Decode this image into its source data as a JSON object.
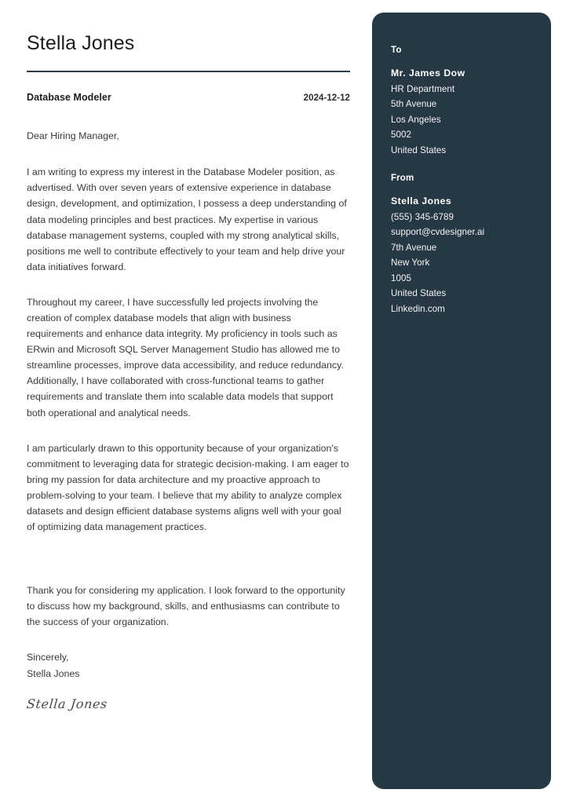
{
  "document": {
    "type": "cover-letter",
    "accent_color": "#273845",
    "page_background": "#ffffff",
    "body_text_color": "#3a3a3a"
  },
  "header": {
    "sender_name": "Stella Jones",
    "job_title": "Database Modeler",
    "date": "2024-12-12"
  },
  "letter": {
    "salutation": "Dear Hiring Manager,",
    "paragraphs": [
      "I am writing to express my interest in the Database Modeler position, as advertised. With over seven years of extensive experience in database design, development, and optimization, I possess a deep understanding of data modeling principles and best practices. My expertise in various database management systems, coupled with my strong analytical skills, positions me well to contribute effectively to your team and help drive your data initiatives forward.",
      "Throughout my career, I have successfully led projects involving the creation of complex database models that align with business requirements and enhance data integrity. My proficiency in tools such as ERwin and Microsoft SQL Server Management Studio has allowed me to streamline processes, improve data accessibility, and reduce redundancy. Additionally, I have collaborated with cross-functional teams to gather requirements and translate them into scalable data models that support both operational and analytical needs.",
      "I am particularly drawn to this opportunity because of your organization's commitment to leveraging data for strategic decision-making. I am eager to bring my passion for data architecture and my proactive approach to problem-solving to your team. I believe that my ability to analyze complex datasets and design efficient database systems aligns well with your goal of optimizing data management practices.",
      "Thank you for considering my application. I look forward to the opportunity to discuss how my background, skills, and enthusiasms can contribute to the success of your organization."
    ],
    "closing_salutation": "Sincerely,",
    "closing_name": "Stella Jones",
    "signature": "Stella Jones"
  },
  "sidebar": {
    "to": {
      "label": "To",
      "name": "Mr. James Dow",
      "lines": [
        "HR Department",
        "5th Avenue",
        "Los Angeles",
        "5002",
        "United States"
      ]
    },
    "from": {
      "label": "From",
      "name": "Stella Jones",
      "lines": [
        "(555) 345-6789",
        "support@cvdesigner.ai",
        "7th Avenue",
        "New York",
        "1005",
        "United States",
        "Linkedin.com"
      ]
    }
  }
}
